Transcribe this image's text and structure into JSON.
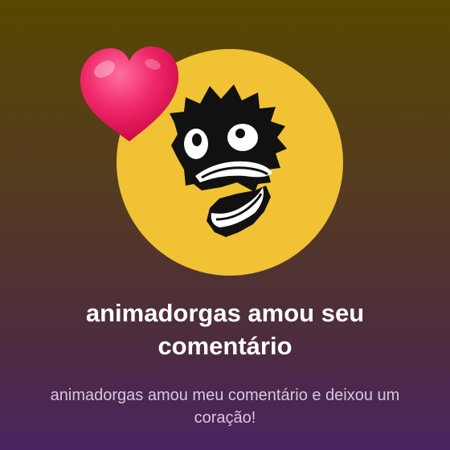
{
  "notification": {
    "title": "animadorgas amou seu comentário",
    "message": "animadorgas amou meu comentário e deixou um coração!"
  },
  "avatar": {
    "icon": "scared-face-avatar",
    "background_color": "#f1c233"
  },
  "reaction": {
    "icon": "heart-icon",
    "color": "#e8175d"
  },
  "colors": {
    "gradient_top": "#574700",
    "gradient_bottom": "#4a2460",
    "title_text": "#ffffff",
    "subtitle_text": "#d8c6de"
  }
}
